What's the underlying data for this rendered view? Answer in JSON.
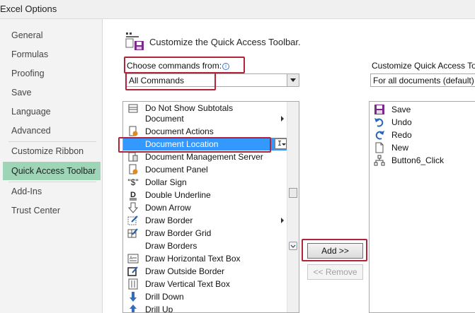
{
  "window": {
    "title": "Excel Options"
  },
  "nav": {
    "items": [
      {
        "id": "general",
        "label": "General"
      },
      {
        "id": "formulas",
        "label": "Formulas"
      },
      {
        "id": "proofing",
        "label": "Proofing"
      },
      {
        "id": "save",
        "label": "Save"
      },
      {
        "id": "language",
        "label": "Language"
      },
      {
        "id": "advanced",
        "label": "Advanced"
      },
      {
        "id": "customize-ribbon",
        "label": "Customize Ribbon"
      },
      {
        "id": "quick-access-toolbar",
        "label": "Quick Access Toolbar",
        "active": true
      },
      {
        "id": "add-ins",
        "label": "Add-Ins"
      },
      {
        "id": "trust-center",
        "label": "Trust Center"
      }
    ]
  },
  "main": {
    "header": "Customize the Quick Access Toolbar.",
    "choose_label": "Choose commands from:",
    "choose_value": "All Commands",
    "customize_label": "Customize Quick Access To",
    "customize_value": "For all documents (default)",
    "commands": [
      {
        "label": "Do Not Show Subtotals",
        "icon": "table-icon"
      },
      {
        "label": "Document",
        "icon": "",
        "submenu": true
      },
      {
        "label": "Document Actions",
        "icon": "document-actions-icon"
      },
      {
        "label": "Document Location",
        "icon": "",
        "selected": true
      },
      {
        "label": "Document Management Server",
        "icon": "document-server-icon"
      },
      {
        "label": "Document Panel",
        "icon": "document-panel-icon"
      },
      {
        "label": "Dollar Sign",
        "icon": "dollar-sign-icon"
      },
      {
        "label": "Double Underline",
        "icon": "double-underline-icon"
      },
      {
        "label": "Down Arrow",
        "icon": "down-arrow-icon"
      },
      {
        "label": "Draw Border",
        "icon": "draw-border-icon",
        "submenu": true
      },
      {
        "label": "Draw Border Grid",
        "icon": "draw-border-grid-icon"
      },
      {
        "label": "Draw Borders",
        "icon": ""
      },
      {
        "label": "Draw Horizontal Text Box",
        "icon": "horizontal-text-box-icon"
      },
      {
        "label": "Draw Outside Border",
        "icon": "outside-border-icon"
      },
      {
        "label": "Draw Vertical Text Box",
        "icon": "vertical-text-box-icon"
      },
      {
        "label": "Drill Down",
        "icon": "drill-down-icon"
      },
      {
        "label": "Drill Up",
        "icon": "drill-up-icon"
      }
    ],
    "qat_commands": [
      {
        "label": "Save",
        "icon": "save-icon"
      },
      {
        "label": "Undo",
        "icon": "undo-icon"
      },
      {
        "label": "Redo",
        "icon": "redo-icon"
      },
      {
        "label": "New",
        "icon": "new-document-icon"
      },
      {
        "label": "Button6_Click",
        "icon": "macro-icon"
      }
    ],
    "add_button": "Add >>",
    "remove_button": "<< Remove",
    "control_glyph": "I"
  },
  "colors": {
    "nav_active": "#9fd5b7",
    "selection": "#3399ff",
    "highlight_box": "#b1253a"
  }
}
